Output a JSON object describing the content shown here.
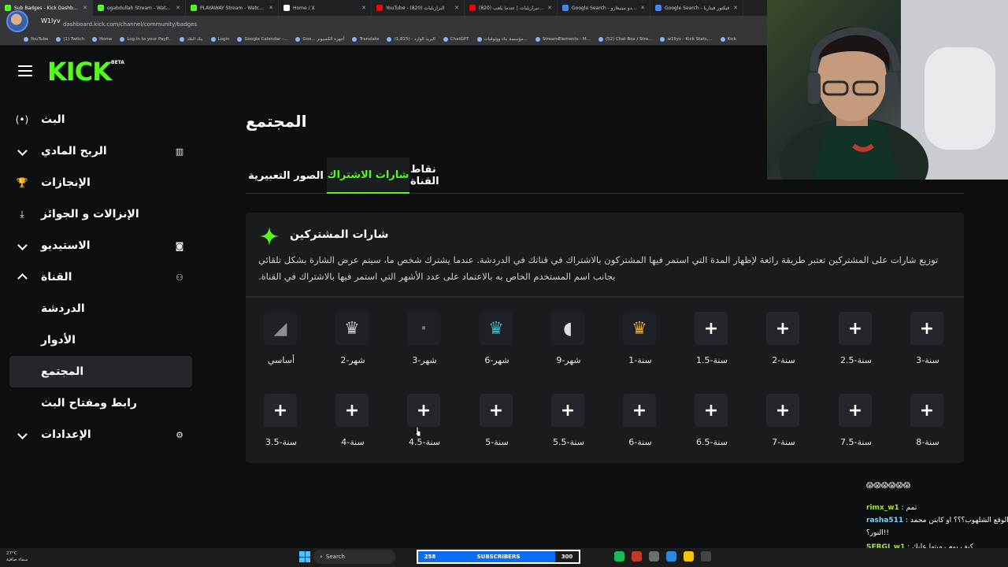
{
  "browser": {
    "tabs": [
      {
        "title": "Sub Badges - Kick Dashboard",
        "color": "#53fc18",
        "active": true
      },
      {
        "title": "ogabdullah Stream - Watch Live",
        "color": "#53fc18",
        "active": false
      },
      {
        "title": "PLAYAWAY Stream - Watch Live",
        "color": "#53fc18",
        "active": false
      },
      {
        "title": "Home / X",
        "color": "#ffffff",
        "active": false
      },
      {
        "title": "YouTube - (820) البرازيليات",
        "color": "#ff0000",
        "active": false
      },
      {
        "title": "(820) نادي الانبرازيليات | عندما يلعب",
        "color": "#ff0000",
        "active": false
      },
      {
        "title": "Google Search - فرناندو مينيغازو",
        "color": "#4285f4",
        "active": false
      },
      {
        "title": "Google Search - فيكتور فيتاريا",
        "color": "#4285f4",
        "active": false
      }
    ],
    "url": "dashboard.kick.com/channel/community/badges",
    "profile_name": "W1lyv",
    "bookmarks": [
      "YouTube",
      "(1) Twitch",
      "Home",
      "Log in to your PayP...",
      "بنك البلاد",
      "Login",
      "Google Calendar -...",
      "Goo... أجهزة الكمبيوتر",
      "Translate",
      "(1,815) - البريد الوارد",
      "ChatGPT",
      "مؤسسة بناء ووثوقيات...",
      "StreamElements - M...",
      "(52) Chat Box / Stre...",
      "w1llyv - Kick Stats,...",
      "Kick"
    ]
  },
  "brand": {
    "logo": "KICK",
    "beta": "BETA",
    "accent": "#53fc18"
  },
  "sidebar": {
    "items": [
      {
        "label": "البث",
        "left_icon": "broadcast-icon",
        "glyph": "(•)",
        "right_icon": null,
        "name": "sidebar-item-stream"
      },
      {
        "label": "الربح المادي",
        "left_icon": "chevron-down-icon",
        "glyph": "",
        "right_icon": "chart-icon",
        "rglyph": "▥",
        "name": "sidebar-item-monetization"
      },
      {
        "label": "الإنجازات",
        "left_icon": "trophy-icon",
        "glyph": "🏆",
        "right_icon": null,
        "name": "sidebar-item-achievements"
      },
      {
        "label": "الإنزالات و الجوائز",
        "left_icon": "drops-icon",
        "glyph": "⤓",
        "right_icon": null,
        "name": "sidebar-item-drops"
      },
      {
        "label": "الاستيديو",
        "left_icon": "chevron-down-icon",
        "glyph": "",
        "right_icon": "studio-icon",
        "rglyph": "◙",
        "name": "sidebar-item-studio"
      },
      {
        "label": "القناة",
        "left_icon": "chevron-up-icon",
        "glyph": "",
        "right_icon": "users-icon",
        "rglyph": "⚇",
        "name": "sidebar-item-channel"
      },
      {
        "label": "الدردشة",
        "sub": true,
        "name": "sidebar-item-chat"
      },
      {
        "label": "الأدوار",
        "sub": true,
        "name": "sidebar-item-roles"
      },
      {
        "label": "المجتمع",
        "sub": true,
        "selected": true,
        "name": "sidebar-item-community"
      },
      {
        "label": "رابط ومفتاح البث",
        "sub": true,
        "name": "sidebar-item-stream-key"
      },
      {
        "label": "الإعدادات",
        "left_icon": "chevron-down-icon",
        "glyph": "",
        "right_icon": "gear-icon",
        "rglyph": "⚙",
        "name": "sidebar-item-settings"
      }
    ]
  },
  "main": {
    "title": "المجتمع",
    "tabs": [
      {
        "label": "الصور التعبيرية",
        "active": false
      },
      {
        "label": "شارات الاشتراك",
        "active": true
      },
      {
        "label": "نقاط القناة",
        "active": false
      }
    ],
    "card": {
      "title": "شارات المشتركين",
      "description": "توزيع شارات على المشتركين تعتبر طريقة رائعة لإظهار المدة التي استمر فيها المشتركون بالاشتراك في قناتك في الدردشة. عندما يشترك شخص ما، سيتم عرض الشارة بشكل تلقائي بجانب اسم المستخدم الخاص به بالاعتماد على عدد الأشهر التي استمر فيها بالاشتراك في القناة."
    },
    "badges": [
      {
        "label": "أساسي",
        "has_image": true,
        "icon": "base-badge-icon",
        "glyph": "◢",
        "color": "#8a8f92"
      },
      {
        "label": "شهر-2",
        "has_image": true,
        "icon": "month2-badge-icon",
        "glyph": "♛",
        "color": "#c9c9c9"
      },
      {
        "label": "شهر-3",
        "has_image": true,
        "icon": "month3-badge-icon",
        "glyph": "·",
        "color": "#777"
      },
      {
        "label": "شهر-6",
        "has_image": true,
        "icon": "month6-badge-icon",
        "glyph": "♛",
        "color": "#3fb6c9"
      },
      {
        "label": "شهر-9",
        "has_image": true,
        "icon": "month9-badge-icon",
        "glyph": "◖",
        "color": "#e0e0e0"
      },
      {
        "label": "سنة-1",
        "has_image": true,
        "icon": "year1-badge-icon",
        "glyph": "♛",
        "color": "#e0a93a"
      },
      {
        "label": "سنة-1.5",
        "has_image": false,
        "glyph": "+"
      },
      {
        "label": "سنة-2",
        "has_image": false,
        "glyph": "+"
      },
      {
        "label": "سنة-2.5",
        "has_image": false,
        "glyph": "+"
      },
      {
        "label": "سنة-3",
        "has_image": false,
        "glyph": "+"
      },
      {
        "label": "سنة-3.5",
        "has_image": false,
        "glyph": "+"
      },
      {
        "label": "سنة-4",
        "has_image": false,
        "glyph": "+"
      },
      {
        "label": "سنة-4.5",
        "has_image": false,
        "glyph": "+"
      },
      {
        "label": "سنة-5",
        "has_image": false,
        "glyph": "+"
      },
      {
        "label": "سنة-5.5",
        "has_image": false,
        "glyph": "+"
      },
      {
        "label": "سنة-6",
        "has_image": false,
        "glyph": "+"
      },
      {
        "label": "سنة-6.5",
        "has_image": false,
        "glyph": "+"
      },
      {
        "label": "سنة-7",
        "has_image": false,
        "glyph": "+"
      },
      {
        "label": "سنة-7.5",
        "has_image": false,
        "glyph": "+"
      },
      {
        "label": "سنة-8",
        "has_image": false,
        "glyph": "+"
      }
    ]
  },
  "chat": {
    "messages": [
      {
        "user": "",
        "text": "😱😱😱😱😱😱"
      },
      {
        "user": "rimx_w1",
        "text": ": تمم"
      },
      {
        "user": "rasha511",
        "text": ": الوقع الشلهوب؟؟؟ او كابتن محمد"
      },
      {
        "user": "",
        "text": "النور؟!!"
      },
      {
        "user": "SERGI_w1",
        "text": ": كيف يوم رميتها عليك"
      },
      {
        "user": "",
        "text": "هاها"
      }
    ]
  },
  "taskbar": {
    "weather": "27°C",
    "weather_sub": "سماء صافية",
    "search": "Search",
    "sub_goal": {
      "current": "258",
      "label": "SUBSCRIBERS",
      "target": "300"
    }
  }
}
